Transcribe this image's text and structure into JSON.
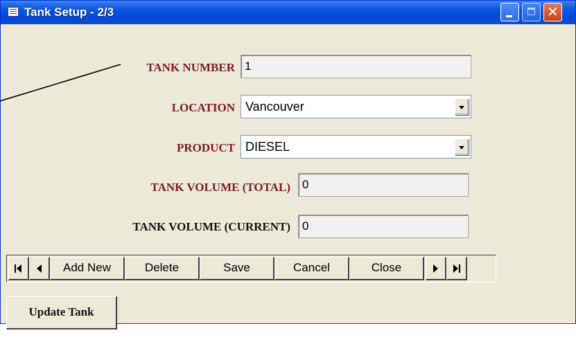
{
  "window": {
    "title": "Tank Setup - 2/3",
    "icons": {
      "app": "form-icon",
      "minimize": "minimize-icon",
      "maximize": "maximize-icon",
      "close": "close-icon"
    },
    "close_glyph": "✕"
  },
  "form": {
    "tank_number": {
      "label": "TANK NUMBER",
      "value": "1"
    },
    "location": {
      "label": "LOCATION",
      "value": "Vancouver"
    },
    "product": {
      "label": "PRODUCT",
      "value": "DIESEL"
    },
    "tank_volume_total": {
      "label": "TANK VOLUME (TOTAL)",
      "value": "0"
    },
    "tank_volume_current": {
      "label": "TANK VOLUME (CURRENT)",
      "value": "0"
    }
  },
  "navigation": {
    "buttons": [
      "Add New",
      "Delete",
      "Save",
      "Cancel",
      "Close"
    ],
    "icons": [
      "first-record-icon",
      "previous-record-icon",
      "next-record-icon",
      "last-record-icon"
    ]
  },
  "update_button": {
    "label": "Update Tank"
  },
  "colors": {
    "label_dark_red": "#7a1e1e",
    "label_black": "#141414",
    "titlebar_blue": "#0a55e0",
    "window_face": "#ece9d8",
    "close_red": "#c8431e"
  }
}
